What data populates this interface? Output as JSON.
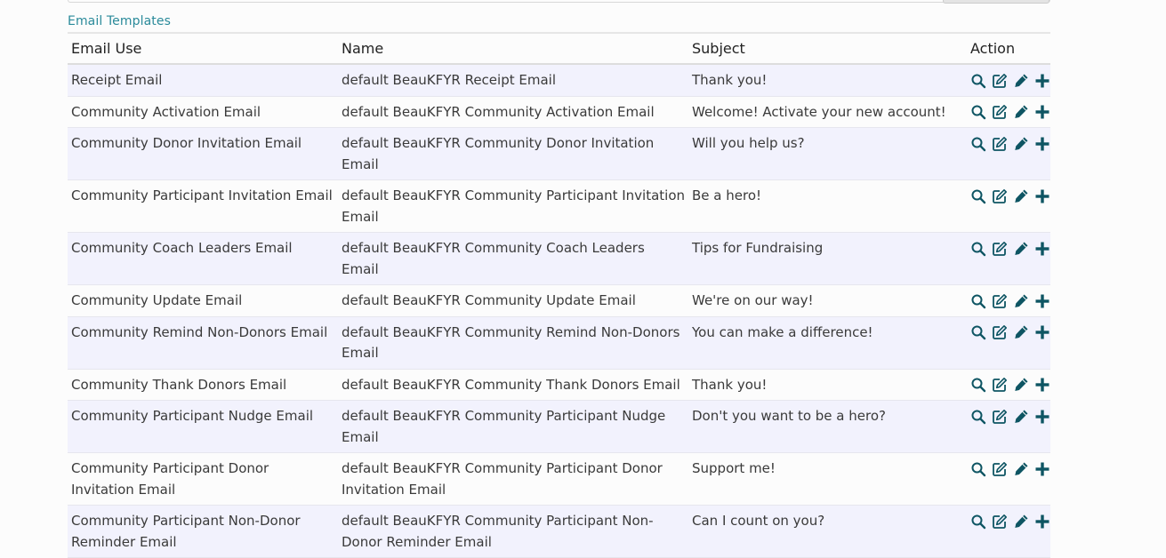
{
  "breadcrumb": "Email Templates",
  "columns": {
    "email_use": "Email Use",
    "name": "Name",
    "subject": "Subject",
    "action": "Action"
  },
  "rows": [
    {
      "email_use": "Receipt Email",
      "name": "default BeauKFYR Receipt Email",
      "subject": "Thank you!"
    },
    {
      "email_use": "Community Activation Email",
      "name": "default BeauKFYR Community Activation Email",
      "subject": "Welcome! Activate your new account!"
    },
    {
      "email_use": "Community Donor Invitation Email",
      "name": "default BeauKFYR Community Donor Invitation Email",
      "subject": "Will you help us?"
    },
    {
      "email_use": "Community Participant Invitation Email",
      "name": "default BeauKFYR Community Participant Invitation Email",
      "subject": "Be a hero!"
    },
    {
      "email_use": "Community Coach Leaders Email",
      "name": "default BeauKFYR Community Coach Leaders Email",
      "subject": "Tips for Fundraising"
    },
    {
      "email_use": "Community Update Email",
      "name": "default BeauKFYR Community Update Email",
      "subject": "We're on our way!"
    },
    {
      "email_use": "Community Remind Non-Donors Email",
      "name": "default BeauKFYR Community Remind Non-Donors Email",
      "subject": "You can make a difference!"
    },
    {
      "email_use": "Community Thank Donors Email",
      "name": "default BeauKFYR Community Thank Donors Email",
      "subject": "Thank you!"
    },
    {
      "email_use": "Community Participant Nudge Email",
      "name": "default BeauKFYR Community Participant Nudge Email",
      "subject": "Don't you want to be a hero?"
    },
    {
      "email_use": "Community Participant Donor Invitation Email",
      "name": "default BeauKFYR Community Participant Donor Invitation Email",
      "subject": "Support me!"
    },
    {
      "email_use": "Community Participant Non-Donor Reminder Email",
      "name": "default BeauKFYR Community Participant Non-Donor Reminder Email",
      "subject": "Can I count on you?"
    }
  ],
  "action_icons": [
    "search-icon",
    "edit-icon",
    "pencil-icon",
    "plus-icon"
  ],
  "colors": {
    "icon": "#0e5563",
    "link": "#2a8a9a",
    "row_alt": "#f2f2fd"
  }
}
